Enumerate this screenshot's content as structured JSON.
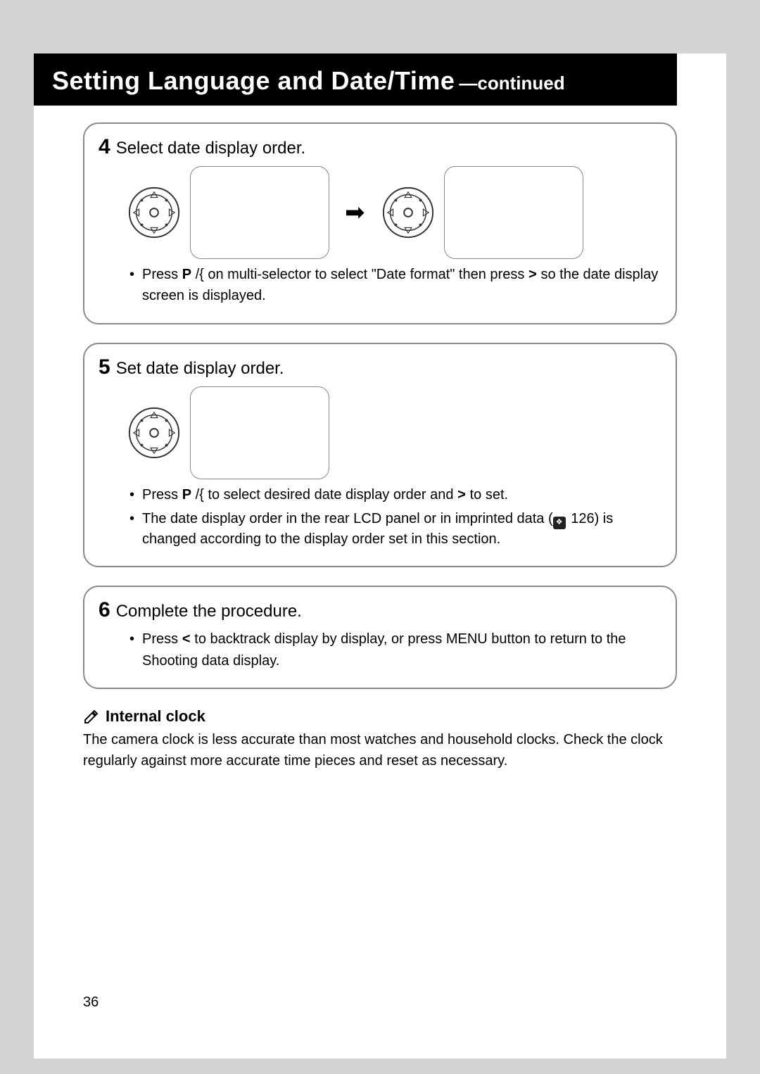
{
  "title": {
    "main": "Setting Language and Date/Time",
    "suffix": "—continued"
  },
  "steps": [
    {
      "num": "4",
      "title": "Select date display order.",
      "bullets": [
        {
          "pre": "Press ",
          "sym1": "P",
          "mid1": " /{   on multi-selector to select \"Date format\" then press ",
          "sym2": ">",
          "post": "  so the date display screen is displayed."
        }
      ],
      "dual_illus": true
    },
    {
      "num": "5",
      "title": "Set date display order.",
      "bullets": [
        {
          "pre": "Press ",
          "sym1": "P",
          "mid1": " /{   to select desired date display order and ",
          "sym2": ">",
          "post": "  to set."
        },
        {
          "plain_pre": "The date display order in the rear LCD panel or in imprinted data (",
          "ref": "126",
          "plain_post": ") is changed according to the display order set in this section."
        }
      ],
      "dual_illus": false
    },
    {
      "num": "6",
      "title": "Complete the procedure.",
      "bullets": [
        {
          "pre": "Press ",
          "sym1": "<",
          "post": "  to backtrack display by display, or press MENU button to return to the Shooting data display."
        }
      ],
      "no_illus": true
    }
  ],
  "note": {
    "title": "Internal clock",
    "body": "The camera clock is less accurate than most watches and household clocks. Check the clock regularly against more accurate time pieces and reset as necessary."
  },
  "page_number": "36"
}
